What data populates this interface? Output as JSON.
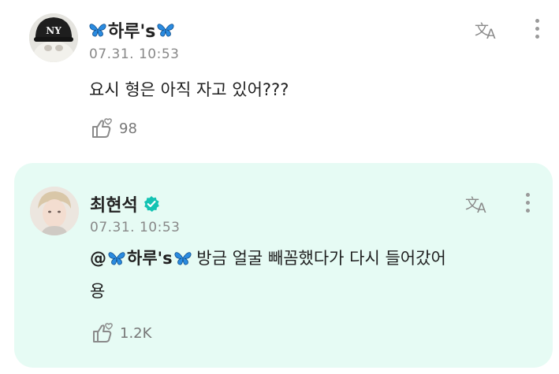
{
  "posts": [
    {
      "author_name": "하루's",
      "timestamp": "07.31. 10:53",
      "text": "요시 형은 아직 자고 있어???",
      "like_count": "98",
      "avatar_icon": "ny-cap-avatar"
    },
    {
      "author_name": "최현석",
      "verified": true,
      "timestamp": "07.31. 10:53",
      "mention": "@하루's",
      "text": "방금 얼굴 빼꼼했다가 다시 들어갔어",
      "text_line2": "용",
      "like_count": "1.2K",
      "highlight_color": "#e6fbf4",
      "avatar_icon": "profile-avatar"
    }
  ],
  "icons": {
    "translate": "translate-icon",
    "more": "more-vertical-icon",
    "like": "like-icon",
    "butterfly": "butterfly-emoji",
    "verified": "verified-badge-icon"
  }
}
